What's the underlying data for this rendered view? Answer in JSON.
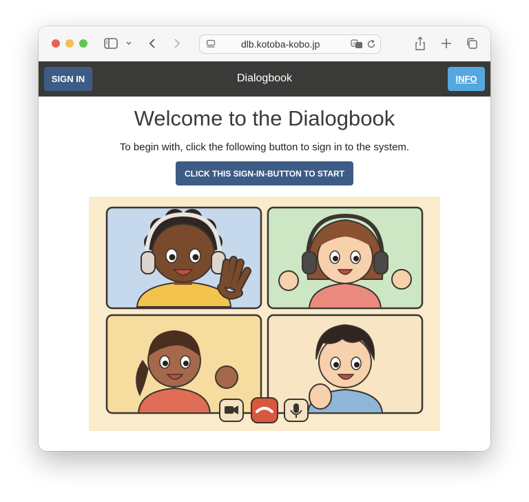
{
  "browser": {
    "url": "dlb.kotoba-kobo.jp",
    "traffic_lights": {
      "close": "#ec5f57",
      "minimize": "#f4be4f",
      "zoom": "#61c454"
    }
  },
  "navbar": {
    "sign_in_label": "SIGN IN",
    "title": "Dialogbook",
    "info_label": "INFO"
  },
  "main": {
    "heading": "Welcome to the Dialogbook",
    "subtitle": "To begin with, click the following button to sign in to the system.",
    "cta_label": "CLICK THIS SIGN-IN-BUTTON TO START"
  },
  "illustration": {
    "panel_colors": [
      "#c6d9ec",
      "#cde7c5",
      "#f6dc9f",
      "#f8e5c4"
    ],
    "background": "#f9ebcc",
    "controls": [
      "video-camera-icon",
      "hang-up-icon",
      "microphone-icon"
    ]
  }
}
